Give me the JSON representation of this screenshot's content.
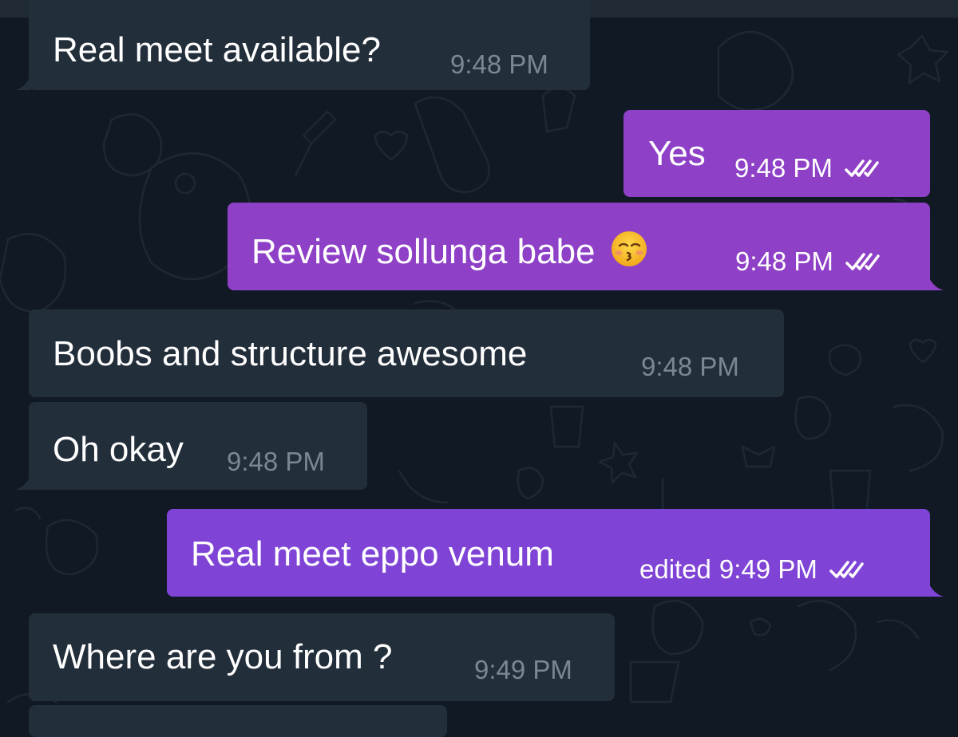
{
  "colors": {
    "background": "#111a24",
    "incoming_bubble": "#222e3a",
    "outgoing_bubble": "#8e40c6",
    "outgoing_bubble_last": "#7f44d6",
    "time_incoming": "#7a8794",
    "text": "#ffffff"
  },
  "messages": [
    {
      "direction": "incoming",
      "text": "Real meet available?",
      "time": "9:48 PM"
    },
    {
      "direction": "outgoing",
      "text": "Yes",
      "time": "9:48 PM",
      "status": "read"
    },
    {
      "direction": "outgoing",
      "text": "Review sollunga babe",
      "emoji": "kissing-face-with-closed-eyes",
      "time": "9:48 PM",
      "status": "read"
    },
    {
      "direction": "incoming",
      "text": "Boobs and structure awesome",
      "time": "9:48 PM"
    },
    {
      "direction": "incoming",
      "text": "Oh okay",
      "time": "9:48 PM"
    },
    {
      "direction": "outgoing",
      "text": "Real meet eppo venum",
      "edited_label": "edited",
      "time": "9:49 PM",
      "status": "read"
    },
    {
      "direction": "incoming",
      "text": "Where are you from ?",
      "time": "9:49 PM"
    }
  ]
}
